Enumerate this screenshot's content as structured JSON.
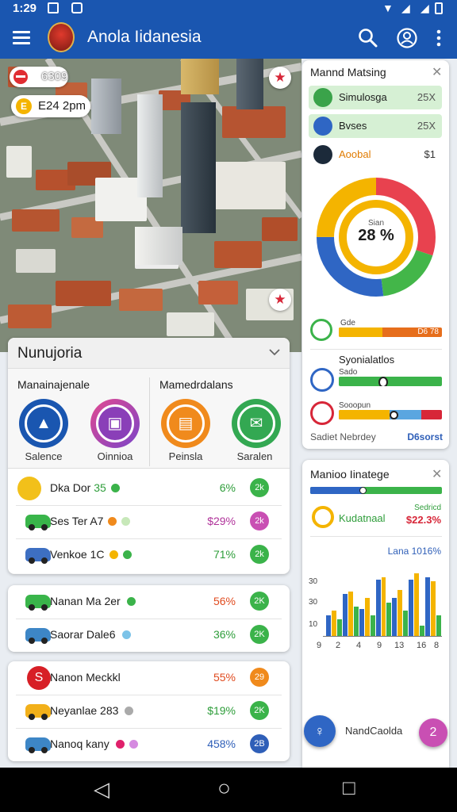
{
  "status_bar": {
    "time": "1:29"
  },
  "app_bar": {
    "title": "Anola Iidanesia"
  },
  "map": {
    "badge_top": "6309",
    "time_chip": "E24 2pm"
  },
  "panel_main": {
    "title": "Nunujoria",
    "section_left": "Manainajenale",
    "section_right": "Mamedrdalans",
    "actions": [
      {
        "label": "Salence",
        "color": "#1a56b0"
      },
      {
        "label": "Oinnioa",
        "color": "#b23ea6"
      },
      {
        "label": "Peinsla",
        "color": "#f08a1c"
      },
      {
        "label": "Saralen",
        "color": "#33a852"
      }
    ],
    "rows": [
      {
        "name": "Dka Dor",
        "num": "35",
        "percent": "6%",
        "badge": "2k",
        "pct_color": "#2e9d3a",
        "badge_color": "#3bb34a",
        "car": "#f2c01a"
      },
      {
        "name": "Ses Ter",
        "num": "A7",
        "percent": "$29%",
        "badge": "2k",
        "pct_color": "#b0339a",
        "badge_color": "#c94fb3",
        "car": "#39b54a"
      },
      {
        "name": "Venkoe",
        "num": "1C",
        "percent": "71%",
        "badge": "2k",
        "pct_color": "#2e9d3a",
        "badge_color": "#3bb34a",
        "car": "#3d6fc2"
      }
    ]
  },
  "panel_b": {
    "rows": [
      {
        "name": "Nanan Ma 2er",
        "percent": "56%",
        "badge": "2K",
        "pct_color": "#e04b1f",
        "badge_color": "#3bb34a",
        "car": "#39b54a"
      },
      {
        "name": "Saorar Dale6",
        "percent": "36%",
        "badge": "2K",
        "pct_color": "#2e9d3a",
        "badge_color": "#3bb34a",
        "car": "#3d86c6"
      }
    ]
  },
  "panel_c": {
    "rows": [
      {
        "name": "Nanon Meckkl",
        "percent": "55%",
        "badge": "29",
        "pct_color": "#e04b1f",
        "badge_color": "#f08a1c",
        "icon": "S"
      },
      {
        "name": "Neyanlae 283",
        "percent": "$19%",
        "badge": "2K",
        "pct_color": "#2e9d3a",
        "badge_color": "#3bb34a",
        "car": "#f2b01a"
      },
      {
        "name": "Nanoq kany",
        "percent": "458%",
        "badge": "2B",
        "pct_color": "#2f5fb8",
        "badge_color": "#2f5fb8",
        "car": "#3d86c6"
      }
    ]
  },
  "side_panel": {
    "title": "Mannd Matsing",
    "items": [
      {
        "name": "Simulosga",
        "value": "25X",
        "bg": "#d6f0d4"
      },
      {
        "name": "Bvses",
        "value": "25X",
        "bg": "#d6f0d4"
      },
      {
        "name": "Aoobal",
        "value": "$1",
        "bg": "#ffffff"
      }
    ],
    "donut_label": "Sian",
    "donut_value": "28 %",
    "donut_segments": [
      {
        "value": 30,
        "color": "#e8424f"
      },
      {
        "value": 18,
        "color": "#43b649"
      },
      {
        "value": 27,
        "color": "#2f66c4"
      },
      {
        "value": 25,
        "color": "#f4b400"
      }
    ],
    "metric1_label": "Gde",
    "metric1_value": "D6 78",
    "metric2_title": "Syonialatlos",
    "metric2_label": "Sado",
    "metric3_label": "Sooopun",
    "footer_left": "Sadiet Nebrdey",
    "footer_right": "D6sorst"
  },
  "side_panel2": {
    "title": "Manioo Iinatege",
    "status_name": "Kudatnaal",
    "status_small": "Sedricd",
    "status_value": "$22.3%",
    "chart_caption": "Lana 1016%",
    "chart_y_labels": [
      "30",
      "30",
      "10"
    ],
    "chart_x_labels": [
      "9",
      "2",
      "4",
      "9",
      "13",
      "16",
      "8"
    ],
    "fab_left_label": "NandCaolda"
  },
  "chart_data": {
    "type": "bar",
    "title": "Lana 1016%",
    "categories": [
      "9",
      "2",
      "4",
      "9",
      "13",
      "16",
      "8"
    ],
    "series": [
      {
        "values": [
          10,
          20,
          13,
          27,
          18,
          27,
          28
        ],
        "color": "#2f66c4"
      },
      {
        "values": [
          12,
          21,
          18,
          28,
          22,
          30,
          26
        ],
        "color": "#f4b400"
      },
      {
        "values": [
          8,
          14,
          10,
          16,
          12,
          5,
          10
        ],
        "color": "#3bb34a"
      }
    ],
    "ylim": [
      0,
      34
    ]
  },
  "nav": {
    "back": "◁",
    "home": "○",
    "recents": "□"
  }
}
